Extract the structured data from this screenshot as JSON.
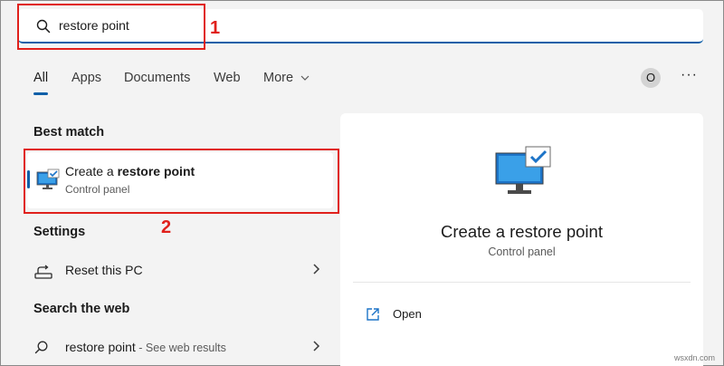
{
  "search": {
    "query": "restore point",
    "icon": "search-icon"
  },
  "annotations": [
    "1",
    "2"
  ],
  "tabs": [
    {
      "label": "All",
      "active": true
    },
    {
      "label": "Apps"
    },
    {
      "label": "Documents"
    },
    {
      "label": "Web"
    },
    {
      "label": "More",
      "icon": "chevron-down-icon"
    }
  ],
  "account": {
    "initial": "O"
  },
  "more_options": "···",
  "best_match": {
    "heading": "Best match",
    "title_prefix": "Create a ",
    "title_bold": "restore point",
    "subtitle": "Control panel",
    "icon": "monitor-check-icon"
  },
  "settings": {
    "heading": "Settings",
    "items": [
      {
        "label": "Reset this PC",
        "icon": "reset-pc-icon"
      }
    ]
  },
  "web": {
    "heading": "Search the web",
    "items": [
      {
        "label": "restore point",
        "suffix": " - See web results",
        "icon": "search-icon"
      }
    ]
  },
  "preview": {
    "title": "Create a restore point",
    "subtitle": "Control panel",
    "actions": [
      {
        "label": "Open",
        "icon": "open-external-icon"
      }
    ]
  },
  "watermark": "wsxdn.com",
  "colors": {
    "accent": "#0f5fa8",
    "annotation": "#e0201b",
    "panel": "#ffffff",
    "background": "#f3f3f3"
  }
}
